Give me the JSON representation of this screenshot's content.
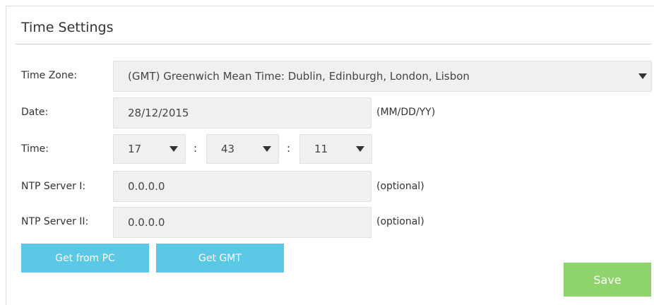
{
  "title": "Time Settings",
  "time_zone": {
    "label": "Time Zone:",
    "selected": "(GMT) Greenwich Mean Time: Dublin, Edinburgh, London, Lisbon"
  },
  "date": {
    "label": "Date:",
    "value": "28/12/2015",
    "hint": "(MM/DD/YY)"
  },
  "time": {
    "label": "Time:",
    "hour": "17",
    "minute": "43",
    "second": "11",
    "separator": ":"
  },
  "ntp1": {
    "label": "NTP Server I:",
    "value": "0.0.0.0",
    "hint": "(optional)"
  },
  "ntp2": {
    "label": "NTP Server II:",
    "value": "0.0.0.0",
    "hint": "(optional)"
  },
  "buttons": {
    "get_from_pc": "Get from PC",
    "get_gmt": "Get GMT",
    "save": "Save"
  },
  "colors": {
    "button_blue": "#5bc8e6",
    "button_green": "#8fd36b",
    "field_bg": "#f0f0f0"
  }
}
